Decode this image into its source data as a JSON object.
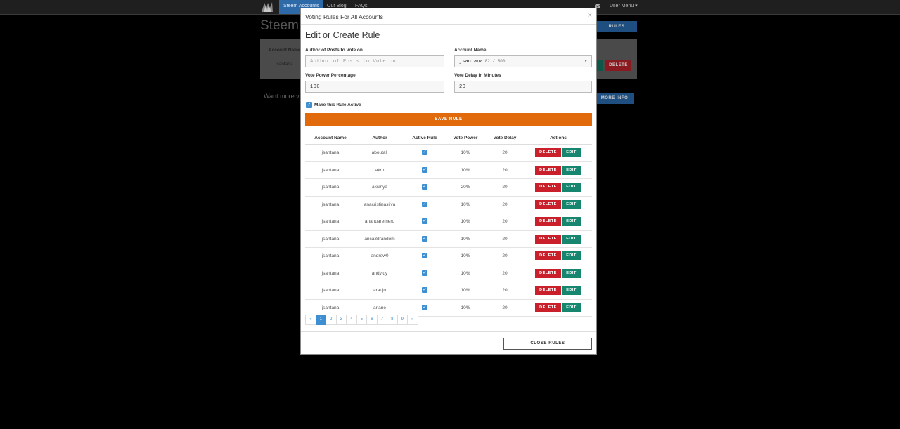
{
  "navbar": {
    "items": [
      {
        "label": "Steem Accounts",
        "active": true
      },
      {
        "label": "Our Blog",
        "active": false
      },
      {
        "label": "FAQs",
        "active": false
      }
    ],
    "user_menu": "User Menu ▾"
  },
  "background": {
    "title": "Steem A",
    "column_header": "Account Name",
    "row_value": "jsantana",
    "rules_button": "RULES",
    "delete_button": "DELETE",
    "more_info_button": "MORE INFO",
    "text": "Want more vo"
  },
  "modal": {
    "title": "Voting Rules For All Accounts",
    "close_symbol": "×",
    "section_title": "Edit or Create Rule",
    "form": {
      "author_label": "Author of Posts to Vote on",
      "author_placeholder": "Author of Posts to Vote on",
      "author_value": "",
      "account_label": "Account Name",
      "account_value": "jsantana",
      "account_sub": "82 / 500",
      "vote_power_label": "Vote Power Percentage",
      "vote_power_value": "100",
      "vote_delay_label": "Vote Delay in Minutes",
      "vote_delay_value": "20",
      "active_checkbox_label": "Make this Rule Active",
      "active_checked": true,
      "save_button": "SAVE RULE"
    },
    "table": {
      "headers": [
        "Account Name",
        "Author",
        "Active Rule",
        "Vote Power",
        "Vote Delay",
        "Actions"
      ],
      "rows": [
        {
          "account": "jsantana",
          "author": "aboutall",
          "active": true,
          "power": "10%",
          "delay": "20"
        },
        {
          "account": "jsantana",
          "author": "akro",
          "active": true,
          "power": "10%",
          "delay": "20"
        },
        {
          "account": "jsantana",
          "author": "aksinya",
          "active": true,
          "power": "20%",
          "delay": "20"
        },
        {
          "account": "jsantana",
          "author": "anacristinasilva",
          "active": true,
          "power": "10%",
          "delay": "20"
        },
        {
          "account": "jsantana",
          "author": "ananuaremero",
          "active": true,
          "power": "10%",
          "delay": "20"
        },
        {
          "account": "jsantana",
          "author": "anca3drandom",
          "active": true,
          "power": "10%",
          "delay": "20"
        },
        {
          "account": "jsantana",
          "author": "andrew0",
          "active": true,
          "power": "10%",
          "delay": "20"
        },
        {
          "account": "jsantana",
          "author": "andyluy",
          "active": true,
          "power": "10%",
          "delay": "20"
        },
        {
          "account": "jsantana",
          "author": "araujo",
          "active": true,
          "power": "10%",
          "delay": "20"
        },
        {
          "account": "jsantana",
          "author": "ariane",
          "active": true,
          "power": "10%",
          "delay": "20"
        }
      ],
      "delete_label": "DELETE",
      "edit_label": "EDIT"
    },
    "pagination": {
      "prev": "«",
      "pages": [
        "1",
        "2",
        "3",
        "4",
        "5",
        "6",
        "7",
        "8",
        "9"
      ],
      "active_page": "1",
      "next": "»"
    },
    "close_button": "CLOSE RULES"
  },
  "colors": {
    "accent_blue": "#3d8fd1",
    "save_orange": "#e06a0c",
    "delete_red": "#c9202b",
    "edit_green": "#16876e"
  }
}
